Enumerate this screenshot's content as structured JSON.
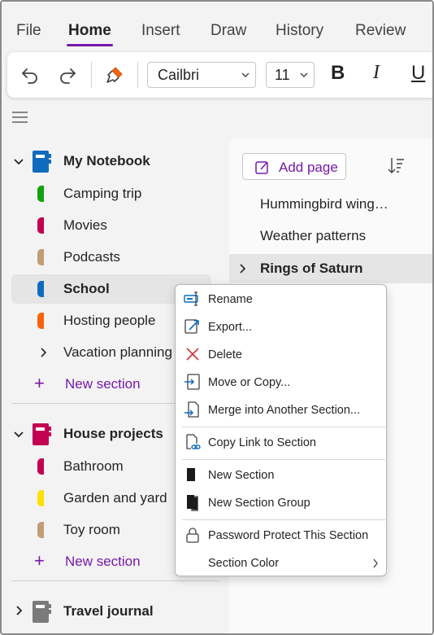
{
  "menu": {
    "items": [
      "File",
      "Home",
      "Insert",
      "Draw",
      "History",
      "Review"
    ],
    "active": "Home"
  },
  "toolbar": {
    "undo_icon": "undo-icon",
    "redo_icon": "redo-icon",
    "format_painter_icon": "format-painter-icon",
    "font": "Cailbri",
    "font_size": "11",
    "bold": "B",
    "italic": "I",
    "underline": "U"
  },
  "notebooks": [
    {
      "name": "My Notebook",
      "color": "#0f6cbd",
      "expanded": true,
      "sections": [
        {
          "label": "Camping trip",
          "color": "#13a10e"
        },
        {
          "label": "Movies",
          "color": "#c30052"
        },
        {
          "label": "Podcasts",
          "color": "#c19c77"
        },
        {
          "label": "School",
          "color": "#0f6cbd",
          "selected": true
        },
        {
          "label": "Hosting people",
          "color": "#f7630c"
        }
      ],
      "section_group": "Vacation planning",
      "new_section": "New section"
    },
    {
      "name": "House projects",
      "color": "#c30052",
      "expanded": true,
      "sections": [
        {
          "label": "Bathroom",
          "color": "#c30052"
        },
        {
          "label": "Garden and yard",
          "color": "#fce100"
        },
        {
          "label": "Toy room",
          "color": "#c19c77"
        }
      ],
      "new_section": "New section"
    },
    {
      "name": "Travel journal",
      "color": "#7a7a7a",
      "expanded": false
    }
  ],
  "pages": {
    "add_page": "Add page",
    "items": [
      "Hummingbird wing…",
      "Weather patterns",
      "Rings of Saturn"
    ],
    "selected": "Rings of Saturn"
  },
  "context_menu": {
    "rename": "Rename",
    "export": "Export...",
    "delete": "Delete",
    "move_copy": "Move or Copy...",
    "merge": "Merge into Another Section...",
    "copy_link": "Copy Link to Section",
    "new_section": "New Section",
    "new_section_group": "New Section Group",
    "password": "Password Protect This Section",
    "section_color": "Section Color"
  },
  "colors": {
    "accent": "#7719aa",
    "delete_red": "#d13438",
    "icon_blue": "#0f6cbd"
  }
}
